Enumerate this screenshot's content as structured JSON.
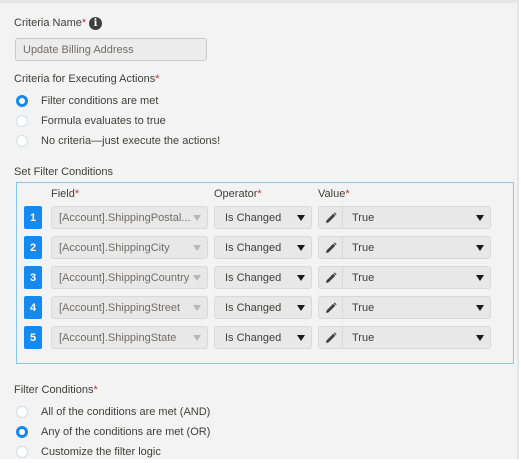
{
  "criteria_name": {
    "label": "Criteria Name",
    "required_mark": "*",
    "info_icon": "info-icon",
    "value": "Update Billing Address"
  },
  "criteria_executing": {
    "label": "Criteria for Executing Actions",
    "required_mark": "*",
    "options": [
      {
        "label": "Filter conditions are met",
        "checked": true
      },
      {
        "label": "Formula evaluates to true",
        "checked": false
      },
      {
        "label": "No criteria—just execute the actions!",
        "checked": false
      }
    ]
  },
  "set_filter": {
    "label": "Set Filter Conditions",
    "headers": {
      "field": "Field",
      "operator": "Operator",
      "value": "Value",
      "required_mark": "*"
    },
    "rows": [
      {
        "num": "1",
        "field": "[Account].ShippingPostal...",
        "operator": "Is Changed",
        "value": "True"
      },
      {
        "num": "2",
        "field": "[Account].ShippingCity",
        "operator": "Is Changed",
        "value": "True"
      },
      {
        "num": "3",
        "field": "[Account].ShippingCountry",
        "operator": "Is Changed",
        "value": "True"
      },
      {
        "num": "4",
        "field": "[Account].ShippingStreet",
        "operator": "Is Changed",
        "value": "True"
      },
      {
        "num": "5",
        "field": "[Account].ShippingState",
        "operator": "Is Changed",
        "value": "True"
      }
    ]
  },
  "filter_conditions": {
    "label": "Filter Conditions",
    "required_mark": "*",
    "options": [
      {
        "label": "All of the conditions are met (AND)",
        "checked": false
      },
      {
        "label": "Any of the conditions are met (OR)",
        "checked": true
      },
      {
        "label": "Customize the filter logic",
        "checked": false
      }
    ]
  },
  "colors": {
    "accent": "#1589ee",
    "required": "#c23934",
    "filter_border": "#8ac4f0"
  }
}
